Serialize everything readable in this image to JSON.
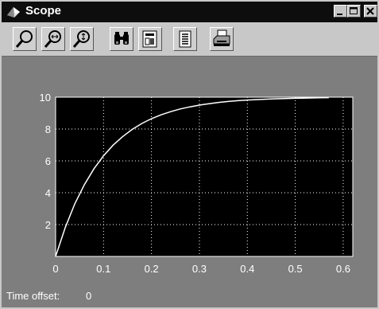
{
  "window": {
    "title": "Scope"
  },
  "toolbar": {
    "buttons": [
      {
        "name": "zoom-icon"
      },
      {
        "name": "zoom-x-icon"
      },
      {
        "name": "zoom-y-icon"
      },
      {
        "name": "autoscale-binoculars-icon"
      },
      {
        "name": "save-axes-icon"
      },
      {
        "name": "parameters-icon"
      },
      {
        "name": "print-icon"
      }
    ]
  },
  "status": {
    "time_offset_label": "Time offset:",
    "time_offset_value": "0"
  },
  "colors": {
    "plot_background": "#000000",
    "trace": "#ffffff",
    "grid": "#ffffff",
    "window_background": "#7e7e7e"
  },
  "chart_data": {
    "type": "line",
    "xlim": [
      0,
      0.62
    ],
    "ylim": [
      0,
      10
    ],
    "xticks": [
      "0",
      "0.1",
      "0.2",
      "0.3",
      "0.4",
      "0.5",
      "0.6"
    ],
    "yticks": [
      "2",
      "4",
      "6",
      "8",
      "10"
    ],
    "grid": true,
    "series": [
      {
        "x": [
          0,
          0.02,
          0.04,
          0.06,
          0.08,
          0.1,
          0.12,
          0.14,
          0.16,
          0.18,
          0.2,
          0.22,
          0.24,
          0.26,
          0.28,
          0.3,
          0.32,
          0.34,
          0.36,
          0.38,
          0.4,
          0.45,
          0.5,
          0.55,
          0.57
        ],
        "y": [
          0,
          1.81,
          3.3,
          4.51,
          5.51,
          6.32,
          6.99,
          7.53,
          7.98,
          8.35,
          8.65,
          8.89,
          9.09,
          9.26,
          9.39,
          9.5,
          9.59,
          9.67,
          9.73,
          9.78,
          9.82,
          9.89,
          9.93,
          9.96,
          9.97
        ]
      }
    ]
  }
}
